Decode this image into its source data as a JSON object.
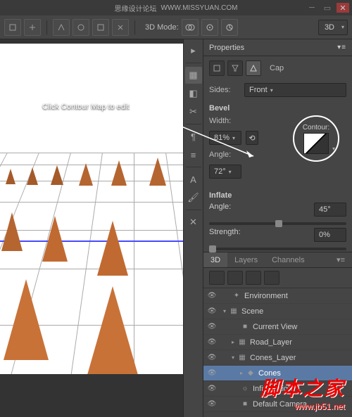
{
  "top": {
    "title1": "思缘设计论坛",
    "title2": "WWW.MISSYUAN.COM"
  },
  "toolbar": {
    "mode_label": "3D Mode:",
    "dd_right": "3D"
  },
  "tooltip": "Click Contour Map to edit",
  "properties": {
    "title": "Properties",
    "cap_label": "Cap",
    "sides_label": "Sides:",
    "sides_value": "Front",
    "bevel_label": "Bevel",
    "width_label": "Width:",
    "width_value": "81%",
    "angle_label": "Angle:",
    "angle_value": "72°",
    "contour_label": "Contour:",
    "inflate_label": "Inflate",
    "inf_angle_label": "Angle:",
    "inf_angle_value": "45°",
    "strength_label": "Strength:",
    "strength_value": "0%"
  },
  "panel3d": {
    "tabs": [
      "3D",
      "Layers",
      "Channels"
    ],
    "items": [
      {
        "name": "Environment",
        "icon": "✦",
        "indent": 0
      },
      {
        "name": "Scene",
        "icon": "▦",
        "indent": 0,
        "tri": "▾"
      },
      {
        "name": "Current View",
        "icon": "■",
        "indent": 1
      },
      {
        "name": "Road_Layer",
        "icon": "▦",
        "indent": 1,
        "tri": "▸"
      },
      {
        "name": "Cones_Layer",
        "icon": "▦",
        "indent": 1,
        "tri": "▾"
      },
      {
        "name": "Cones",
        "icon": "◆",
        "indent": 2,
        "tri": "▸",
        "sel": true
      },
      {
        "name": "Infinite Light 1",
        "icon": "☼",
        "indent": 1
      },
      {
        "name": "Default Camera",
        "icon": "■",
        "indent": 1
      }
    ]
  },
  "watermark": {
    "line1": "脚本之家",
    "line2": "www.jb51.net"
  }
}
